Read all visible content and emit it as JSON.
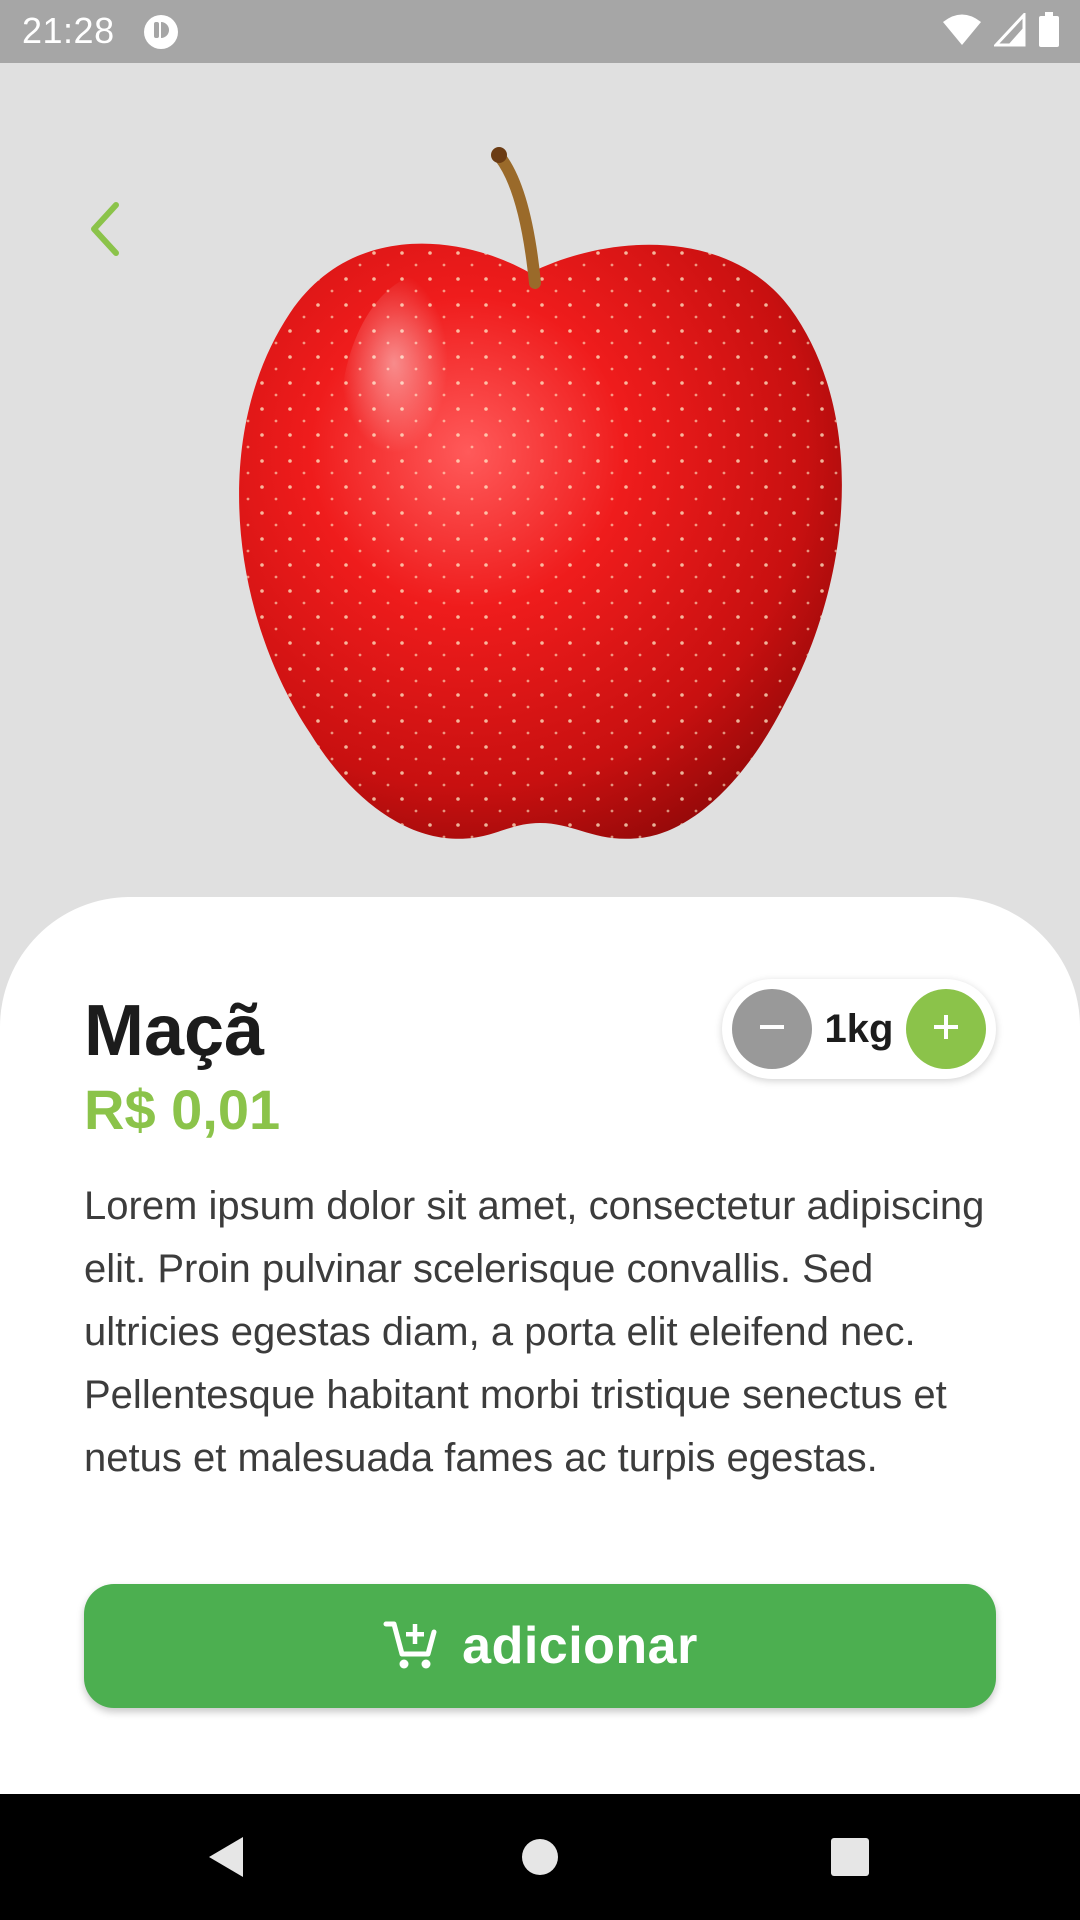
{
  "status_bar": {
    "time": "21:28",
    "icons": [
      "app-notification-icon",
      "wifi-icon",
      "signal-icon",
      "battery-icon"
    ]
  },
  "header": {
    "back_icon": "chevron-left-icon"
  },
  "product": {
    "image": "red-apple",
    "name": "Maçã",
    "price": "R$ 0,01",
    "description": "Lorem ipsum dolor sit amet, consectetur adipiscing elit. Proin pulvinar scelerisque convallis. Sed ultricies egestas diam, a porta elit eleifend nec. Pellentesque habitant morbi tristique senectus et netus et malesuada fames ac turpis egestas."
  },
  "quantity": {
    "value": "1kg",
    "decrement_icon": "minus-icon",
    "increment_icon": "plus-icon"
  },
  "add_button": {
    "label": "adicionar",
    "icon": "add-to-cart-icon"
  },
  "navigation": {
    "buttons": [
      "back-nav-icon",
      "home-nav-icon",
      "recents-nav-icon"
    ]
  },
  "colors": {
    "accent_green": "#8bc34a",
    "button_green": "#4caf50",
    "status_bar": "#a6a6a6",
    "hero_background": "#e0e0e0",
    "minus_button": "#999999"
  }
}
